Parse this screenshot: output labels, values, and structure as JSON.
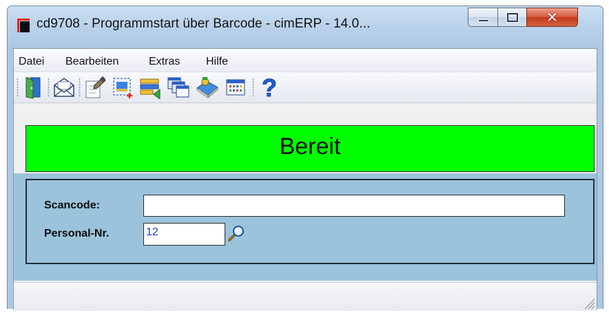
{
  "window": {
    "title": "cd9708  - Programmstart über Barcode - cimERP - 14.0...",
    "buttons": {
      "minimize": "minimize-icon",
      "maximize": "maximize-icon",
      "close": "✕"
    }
  },
  "menu": {
    "items": [
      "Datei",
      "Bearbeiten",
      "Extras",
      "Hilfe"
    ]
  },
  "toolbar": {
    "buttons": [
      "exit-door-icon",
      "mail-envelope-icon",
      "edit-document-icon",
      "new-record-icon",
      "transfer-list-icon",
      "windows-cascade-icon",
      "book-help-icon",
      "calendar-grid-icon",
      "help-question-icon"
    ]
  },
  "status": {
    "text": "Bereit",
    "color": "#00ff00"
  },
  "form": {
    "scancode_label": "Scancode:",
    "scancode_value": "",
    "personal_label": "Personal-Nr.",
    "personal_value": "12"
  },
  "colors": {
    "form_background": "#9bc3db",
    "field_value": "#1a3ec8",
    "close_button": "#c2391c"
  }
}
